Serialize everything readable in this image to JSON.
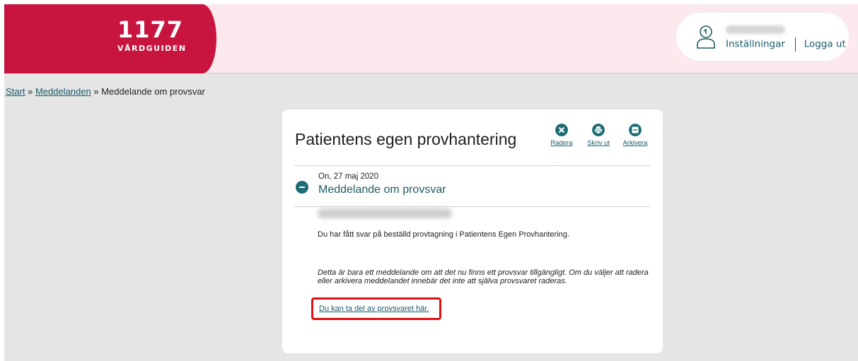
{
  "header": {
    "logo_number": "1177",
    "logo_subtitle": "VÅRDGUIDEN",
    "settings_label": "Inställningar",
    "logout_label": "Logga ut"
  },
  "breadcrumb": {
    "start": "Start",
    "separator1": " » ",
    "messages": "Meddelanden",
    "separator2": " » ",
    "current": "Meddelande om provsvar"
  },
  "card": {
    "title": "Patientens egen provhantering",
    "actions": {
      "delete": "Radera",
      "print": "Skriv ut",
      "archive": "Arkivera"
    },
    "message": {
      "date": "On, 27 maj 2020",
      "subject": "Meddelande om provsvar",
      "body": "Du har fått svar på beställd provtagning i Patientens Egen Provhantering.",
      "note": "Detta är bara ett meddelande om att det nu finns ett provsvar tillgängligt. Om du väljer att radera eller arkivera meddelandet innebär det inte att själva provsvaret raderas.",
      "result_link": "Du kan ta del av provsvaret här."
    }
  },
  "colors": {
    "brand_red": "#c8153f",
    "header_bg": "#fbe9ee",
    "accent_teal": "#1d6b74",
    "highlight_red": "#e01010"
  },
  "icons": {
    "user": "user-icon",
    "delete": "close-circle-icon",
    "print": "printer-icon",
    "archive": "archive-icon",
    "collapse": "minus-circle-icon"
  }
}
